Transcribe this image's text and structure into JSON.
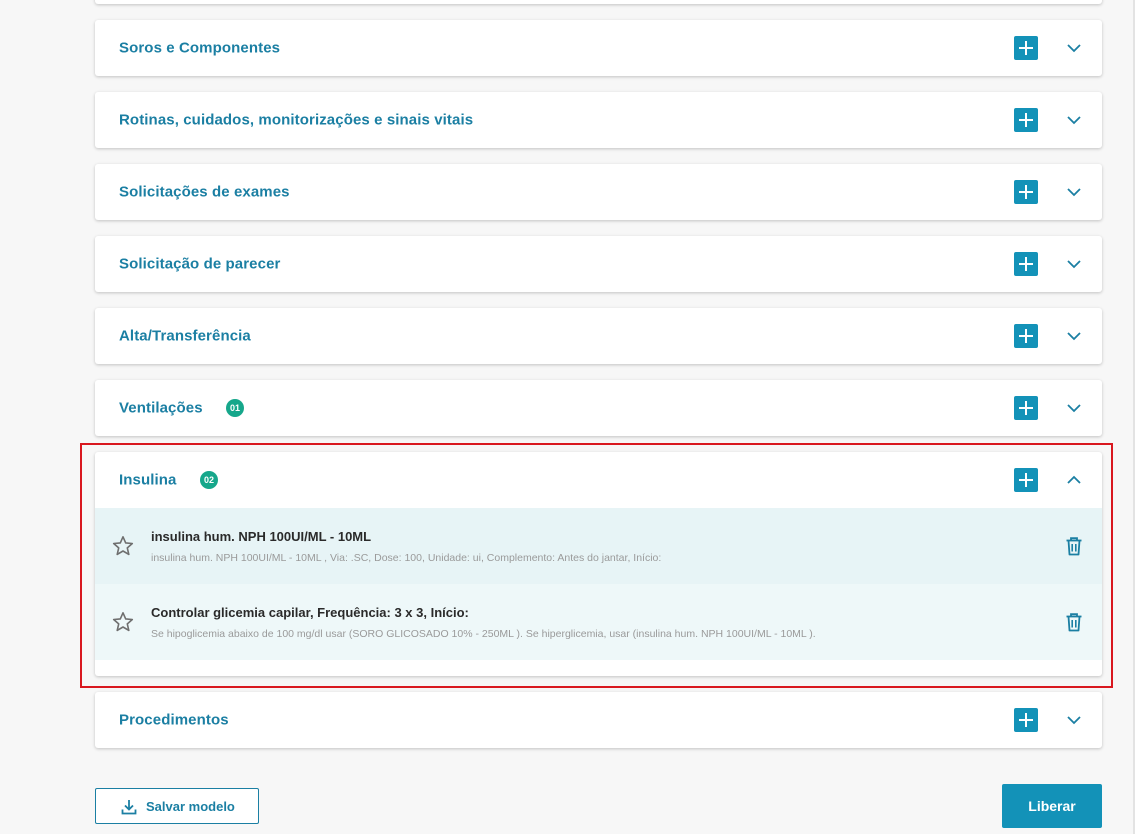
{
  "sections": [
    {
      "id": "soros",
      "title": "Soros e Componentes",
      "badge": null,
      "expanded": false
    },
    {
      "id": "rotinas",
      "title": "Rotinas, cuidados, monitorizações e sinais vitais",
      "badge": null,
      "expanded": false
    },
    {
      "id": "exames",
      "title": "Solicitações de exames",
      "badge": null,
      "expanded": false
    },
    {
      "id": "parecer",
      "title": "Solicitação de parecer",
      "badge": null,
      "expanded": false
    },
    {
      "id": "alta",
      "title": "Alta/Transferência",
      "badge": null,
      "expanded": false
    },
    {
      "id": "ventilacoes",
      "title": "Ventilações",
      "badge": "01",
      "expanded": false
    },
    {
      "id": "insulina",
      "title": "Insulina",
      "badge": "02",
      "expanded": true,
      "items": [
        {
          "title": "insulina hum. NPH 100UI/ML - 10ML",
          "detail": "insulina hum. NPH 100UI/ML - 10ML , Via: .SC, Dose: 100, Unidade: ui, Complemento: Antes do jantar, Início:"
        },
        {
          "title": "Controlar glicemia capilar, Frequência: 3 x 3, Início:",
          "detail": "Se hipoglicemia abaixo de 100 mg/dl usar (SORO GLICOSADO 10% - 250ML ). Se hiperglicemia, usar (insulina hum. NPH 100UI/ML - 10ML )."
        }
      ]
    },
    {
      "id": "procedimentos",
      "title": "Procedimentos",
      "badge": null,
      "expanded": false
    }
  ],
  "footer": {
    "save_label": "Salvar modelo",
    "release_label": "Liberar"
  },
  "colors": {
    "accent": "#1392b8",
    "title": "#1b7fa3",
    "badge": "#16a78b",
    "highlight": "#d9181f"
  },
  "icons": [
    "plus-icon",
    "chevron-down-icon",
    "chevron-up-icon",
    "star-icon",
    "trash-icon",
    "download-icon"
  ]
}
